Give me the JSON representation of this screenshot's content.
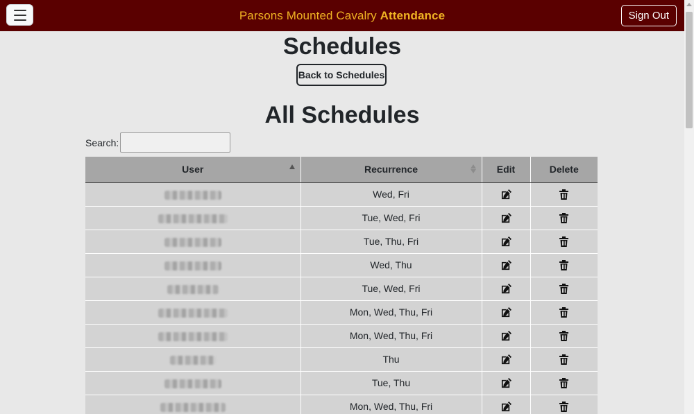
{
  "header": {
    "brand_plain": "Parsons Mounted Cavalry",
    "brand_bold": "Attendance",
    "signout_label": "Sign Out",
    "menu_icon": "hamburger-menu-icon"
  },
  "page": {
    "title": "Schedules",
    "back_label": "Back to Schedules",
    "section_title": "All Schedules"
  },
  "search": {
    "label": "Search:",
    "value": ""
  },
  "table": {
    "columns": [
      "User",
      "Recurrence",
      "Edit",
      "Delete"
    ],
    "rows": [
      {
        "user": "",
        "recurrence": "Wed, Fri"
      },
      {
        "user": "",
        "recurrence": "Tue, Wed, Fri"
      },
      {
        "user": "",
        "recurrence": "Tue, Thu, Fri"
      },
      {
        "user": "",
        "recurrence": "Wed, Thu"
      },
      {
        "user": "",
        "recurrence": "Tue, Wed, Fri"
      },
      {
        "user": "",
        "recurrence": "Mon, Wed, Thu, Fri"
      },
      {
        "user": "",
        "recurrence": "Mon, Wed, Thu, Fri"
      },
      {
        "user": "",
        "recurrence": "Thu"
      },
      {
        "user": "",
        "recurrence": "Tue, Thu"
      },
      {
        "user": "",
        "recurrence": "Mon, Wed, Thu, Fri"
      }
    ],
    "edit_icon": "edit-icon",
    "delete_icon": "trash-icon"
  },
  "colors": {
    "navbar": "#5a0000",
    "brand": "#f0b323",
    "header_cell": "#a6a6a6",
    "body_cell": "#d3d3d3"
  }
}
